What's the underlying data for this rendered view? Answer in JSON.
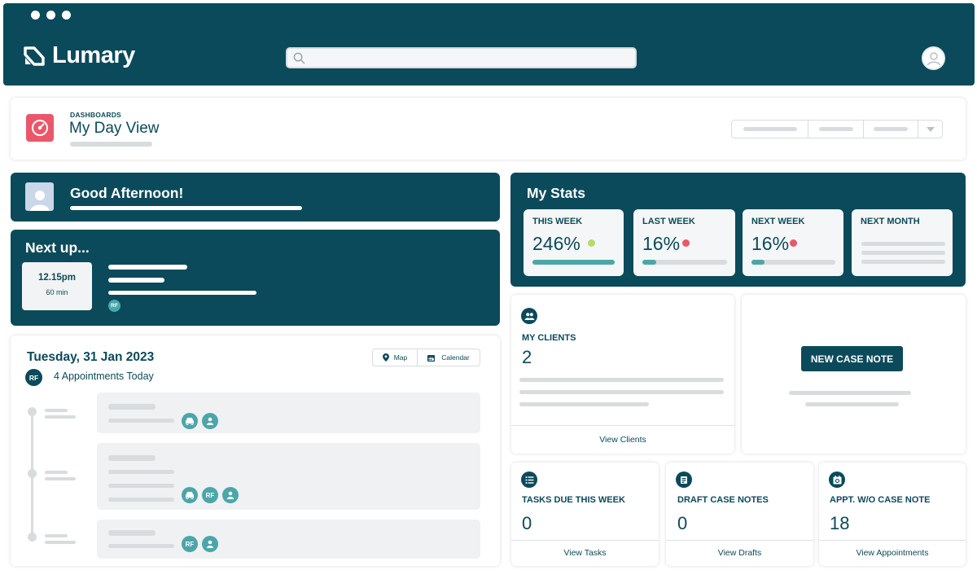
{
  "colors": {
    "brand": "#0b4a5a",
    "accent": "#4ba6aa",
    "alert": "#e9586a",
    "positive": "#b9d86a"
  },
  "app": {
    "name": "Lumary"
  },
  "header": {
    "dashboards_label": "DASHBOARDS",
    "title": "My Day View"
  },
  "greeting": {
    "text": "Good Afternoon!"
  },
  "next_up": {
    "title": "Next up...",
    "time": "12.15pm",
    "duration": "60 min",
    "initials": "RF"
  },
  "schedule": {
    "date": "Tuesday, 31 Jan 2023",
    "initials": "RF",
    "summary": "4 Appointments Today",
    "map_button": "Map",
    "calendar_button": "Calendar",
    "badge_initials": "RF"
  },
  "stats": {
    "title": "My Stats",
    "items": [
      {
        "label": "THIS WEEK",
        "value": "246%",
        "status": "positive",
        "progress": 1.0
      },
      {
        "label": "LAST WEEK",
        "value": "16%",
        "status": "alert",
        "progress": 0.16
      },
      {
        "label": "NEXT WEEK",
        "value": "16%",
        "status": "alert",
        "progress": 0.16
      },
      {
        "label": "NEXT MONTH"
      }
    ]
  },
  "clients": {
    "label": "MY CLIENTS",
    "count": "2",
    "link": "View Clients"
  },
  "new_case_note": {
    "label": "NEW CASE NOTE"
  },
  "tiles": [
    {
      "label": "TASKS DUE THIS WEEK",
      "value": "0",
      "link": "View Tasks"
    },
    {
      "label": "DRAFT CASE NOTES",
      "value": "0",
      "link": "View Drafts"
    },
    {
      "label": "APPT. W/O CASE NOTE",
      "value": "18",
      "link": "View Appointments"
    }
  ]
}
